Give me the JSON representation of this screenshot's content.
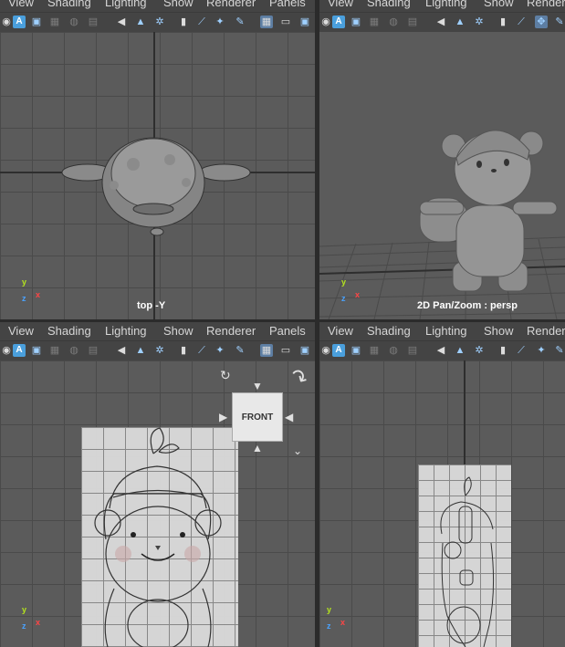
{
  "menu": [
    "View",
    "Shading",
    "Lighting",
    "Show",
    "Renderer",
    "Panels"
  ],
  "panes": {
    "top_left": {
      "label": "top -Y"
    },
    "top_right": {
      "label": "2D Pan/Zoom : persp",
      "menu_last": "Rendere"
    },
    "bottom_left": {
      "viewcube": "FRONT"
    },
    "bottom_right": {
      "menu_last": "Rendere"
    }
  },
  "axes": {
    "y": "y",
    "x": "x",
    "z": "z"
  },
  "icons": [
    "select-all-icon",
    "frame-icon",
    "camera-icon",
    "grid-icon",
    "film-gate-icon",
    "resolution-gate-icon",
    "bookmark-icon",
    "wireframe-icon",
    "shaded-icon",
    "light-icon",
    "isolate-icon",
    "xray-icon"
  ],
  "colors": {
    "accent": "#4a9fdc",
    "axis_x": "#ff4545",
    "axis_y": "#b5e51d",
    "axis_z": "#4aa3ff"
  }
}
